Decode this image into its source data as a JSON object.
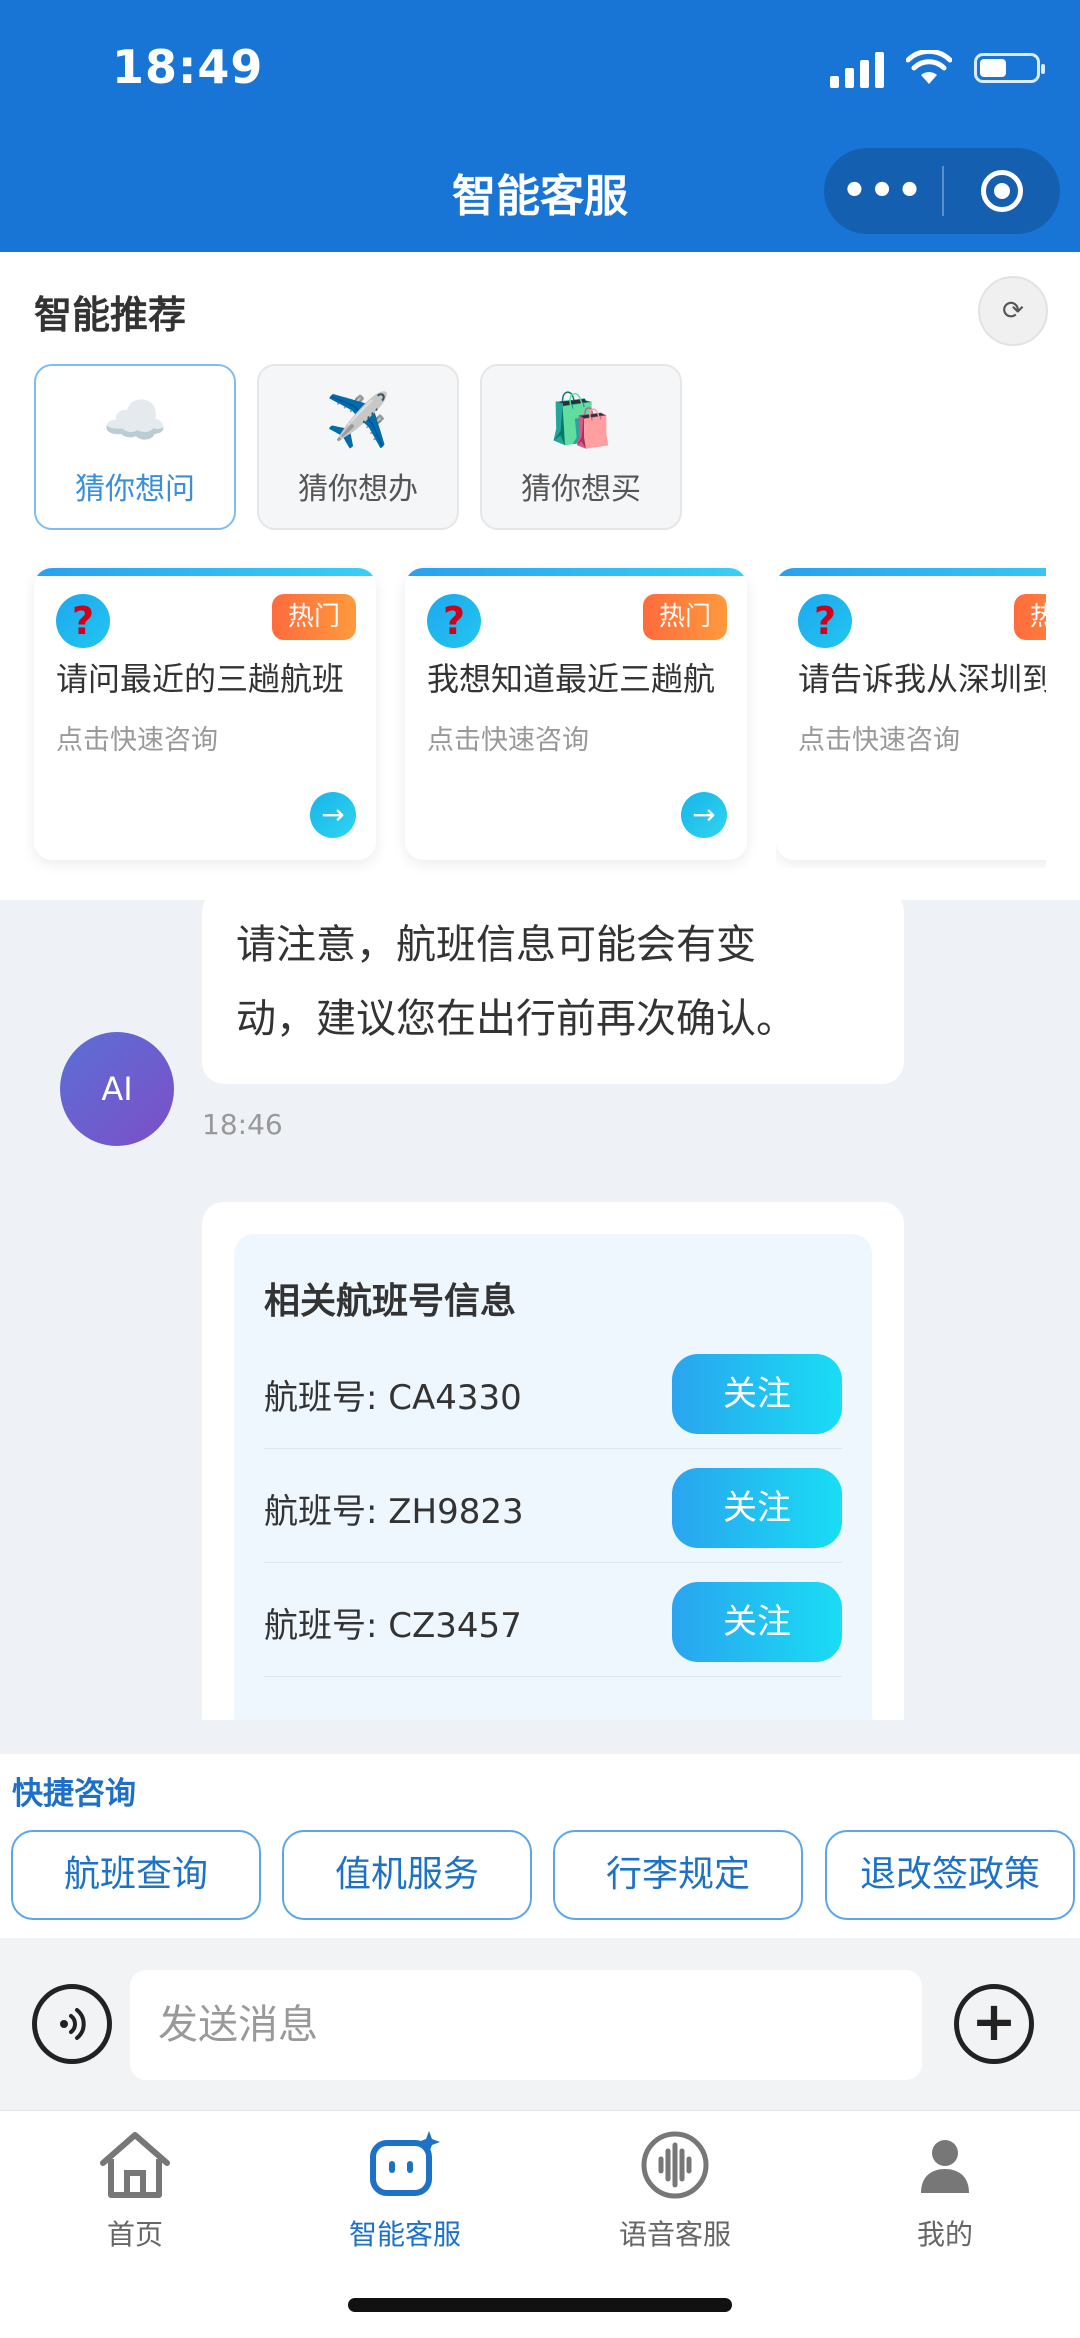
{
  "status_bar": {
    "time": "18:49"
  },
  "nav": {
    "title": "智能客服",
    "more_label": "•••"
  },
  "recommend": {
    "title": "智能推荐",
    "refresh_label": "⟳",
    "categories": [
      {
        "label": "猜你想问",
        "icon": "☁️",
        "active": true
      },
      {
        "label": "猜你想办",
        "icon": "✈️",
        "active": false
      },
      {
        "label": "猜你想买",
        "icon": "🛍️",
        "active": false
      }
    ],
    "cards": [
      {
        "icon": "?",
        "badge": "热门",
        "text": "请问最近的三趟航班",
        "sub": "点击快速咨询",
        "arrow": "→"
      },
      {
        "icon": "?",
        "badge": "热门",
        "text": "我想知道最近三趟航",
        "sub": "点击快速咨询",
        "arrow": "→"
      },
      {
        "icon": "?",
        "badge": "热门",
        "text": "请告诉我从深圳到",
        "sub": "点击快速咨询",
        "arrow": "→"
      }
    ]
  },
  "chat": {
    "message_lines": [
      "请注意，航班信息可能会有变",
      "动，建议您在出行前再次确认。"
    ],
    "avatar_label": "AI",
    "timestamp": "18:46",
    "flight_info": {
      "title": "相关航班号信息",
      "rows": [
        {
          "flight": "航班号: CA4330",
          "button": "关注"
        },
        {
          "flight": "航班号: ZH9823",
          "button": "关注"
        },
        {
          "flight": "航班号: CZ3457",
          "button": "关注"
        }
      ]
    }
  },
  "quick_consult": {
    "title": "快捷咨询",
    "chips": [
      "航班查询",
      "值机服务",
      "行李规定",
      "退改签政策"
    ]
  },
  "input": {
    "placeholder": "发送消息",
    "plus_label": "+"
  },
  "tabbar": {
    "tabs": [
      {
        "label": "首页",
        "icon": "home-icon"
      },
      {
        "label": "智能客服",
        "icon": "robot-chat-icon",
        "active": true
      },
      {
        "label": "语音客服",
        "icon": "voice-wave-icon"
      },
      {
        "label": "我的",
        "icon": "user-icon"
      }
    ]
  },
  "colors": {
    "header_blue": "#1875d6",
    "accent_blue": "#1d72c7",
    "hot_orange": "#ff7a3c",
    "follow_cyan": "#19ddf4"
  }
}
